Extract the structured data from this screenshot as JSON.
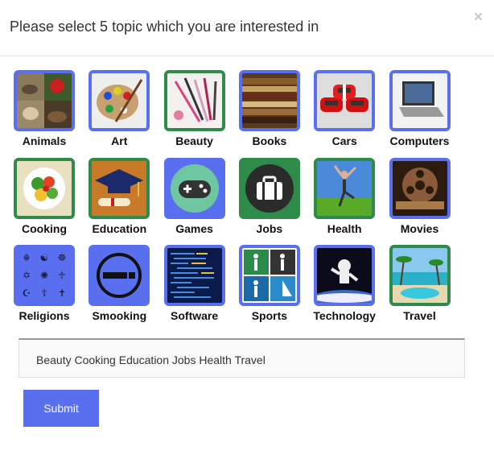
{
  "dialog": {
    "title": "Please select 5 topic which you are interested in",
    "close_glyph": "×"
  },
  "topics": [
    {
      "label": "Animals",
      "selected": false,
      "icon": "animals-photo"
    },
    {
      "label": "Art",
      "selected": false,
      "icon": "art-palette-photo"
    },
    {
      "label": "Beauty",
      "selected": true,
      "icon": "makeup-brushes-photo"
    },
    {
      "label": "Books",
      "selected": false,
      "icon": "books-stack-photo"
    },
    {
      "label": "Cars",
      "selected": false,
      "icon": "red-cars-photo"
    },
    {
      "label": "Computers",
      "selected": false,
      "icon": "laptop-photo"
    },
    {
      "label": "Cooking",
      "selected": true,
      "icon": "salad-photo"
    },
    {
      "label": "Education",
      "selected": true,
      "icon": "graduation-cap-photo"
    },
    {
      "label": "Games",
      "selected": false,
      "icon": "gamepad-icon"
    },
    {
      "label": "Jobs",
      "selected": true,
      "icon": "briefcase-icon"
    },
    {
      "label": "Health",
      "selected": true,
      "icon": "yoga-photo"
    },
    {
      "label": "Movies",
      "selected": false,
      "icon": "film-reel-photo"
    },
    {
      "label": "Religions",
      "selected": false,
      "icon": "religion-symbols-icon"
    },
    {
      "label": "Smooking",
      "selected": false,
      "icon": "cigarette-icon"
    },
    {
      "label": "Software",
      "selected": false,
      "icon": "code-screen-photo"
    },
    {
      "label": "Sports",
      "selected": false,
      "icon": "sports-pictograms-icon"
    },
    {
      "label": "Technology",
      "selected": false,
      "icon": "astronaut-photo"
    },
    {
      "label": "Travel",
      "selected": true,
      "icon": "beach-resort-photo"
    }
  ],
  "selection_field": {
    "value": "Beauty Cooking Education Jobs Health Travel"
  },
  "submit": {
    "label": "Submit"
  },
  "colors": {
    "unselected_border": "#5a6ff0",
    "selected_border": "#2e8b4a",
    "submit_bg": "#5a6ff0"
  }
}
